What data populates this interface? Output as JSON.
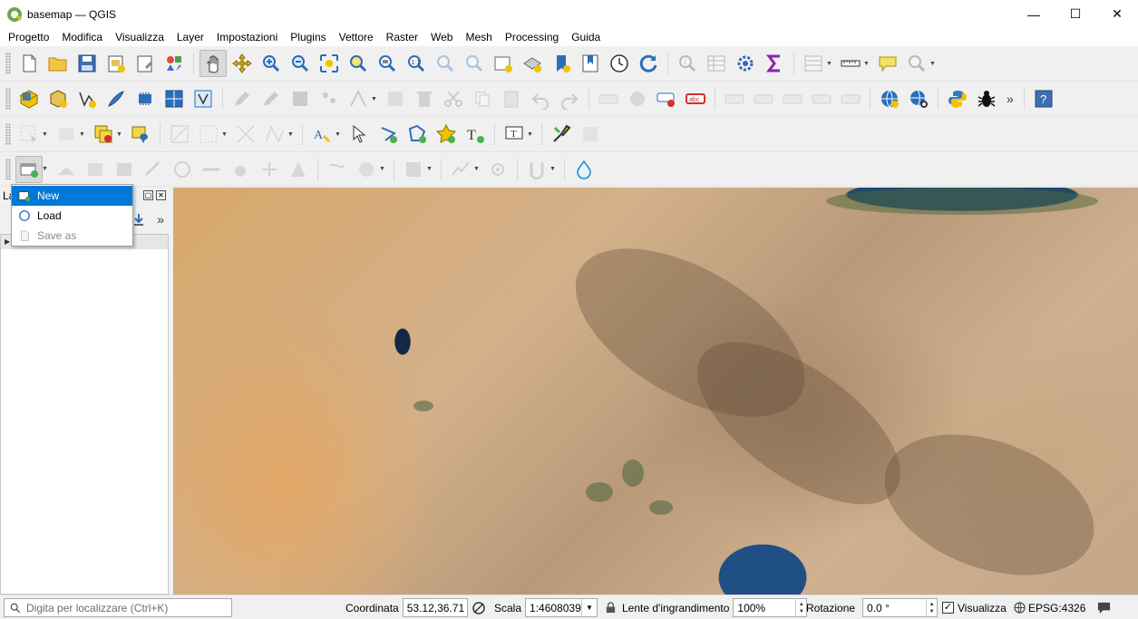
{
  "window": {
    "title": "basemap — QGIS",
    "controls": {
      "minimize": "—",
      "maximize": "☐",
      "close": "✕"
    }
  },
  "menu": [
    "Progetto",
    "Modifica",
    "Visualizza",
    "Layer",
    "Impostazioni",
    "Plugins",
    "Vettore",
    "Raster",
    "Web",
    "Mesh",
    "Processing",
    "Guida"
  ],
  "layers_panel": {
    "title_visible": "La",
    "more": "»"
  },
  "new_layer_menu": {
    "items": [
      {
        "label": "New",
        "highlighted": true,
        "enabled": true
      },
      {
        "label": "Load",
        "highlighted": false,
        "enabled": true
      },
      {
        "label": "Save as",
        "highlighted": false,
        "enabled": false
      }
    ]
  },
  "toolbar": {
    "overflow_1": "»",
    "help_label": "?",
    "identify_label": "i",
    "text_tool_label": "T"
  },
  "statusbar": {
    "locator_placeholder": "Digita per localizzare (Ctrl+K)",
    "coordinate_label": "Coordinata",
    "coordinate_value": "53.12,36.71",
    "scale_label": "Scala",
    "scale_value": "1:4608039",
    "magnifier_label": "Lente d'ingrandimento",
    "magnifier_value": "100%",
    "rotation_label": "Rotazione",
    "rotation_value": "0.0 °",
    "render_label": "Visualizza",
    "render_checked": true,
    "crs_label": "EPSG:4326"
  },
  "colors": {
    "highlight": "#0078d7",
    "accent_green": "#6aa84f",
    "accent_yellow": "#f2c200",
    "icon_blue": "#2a6ebb"
  }
}
